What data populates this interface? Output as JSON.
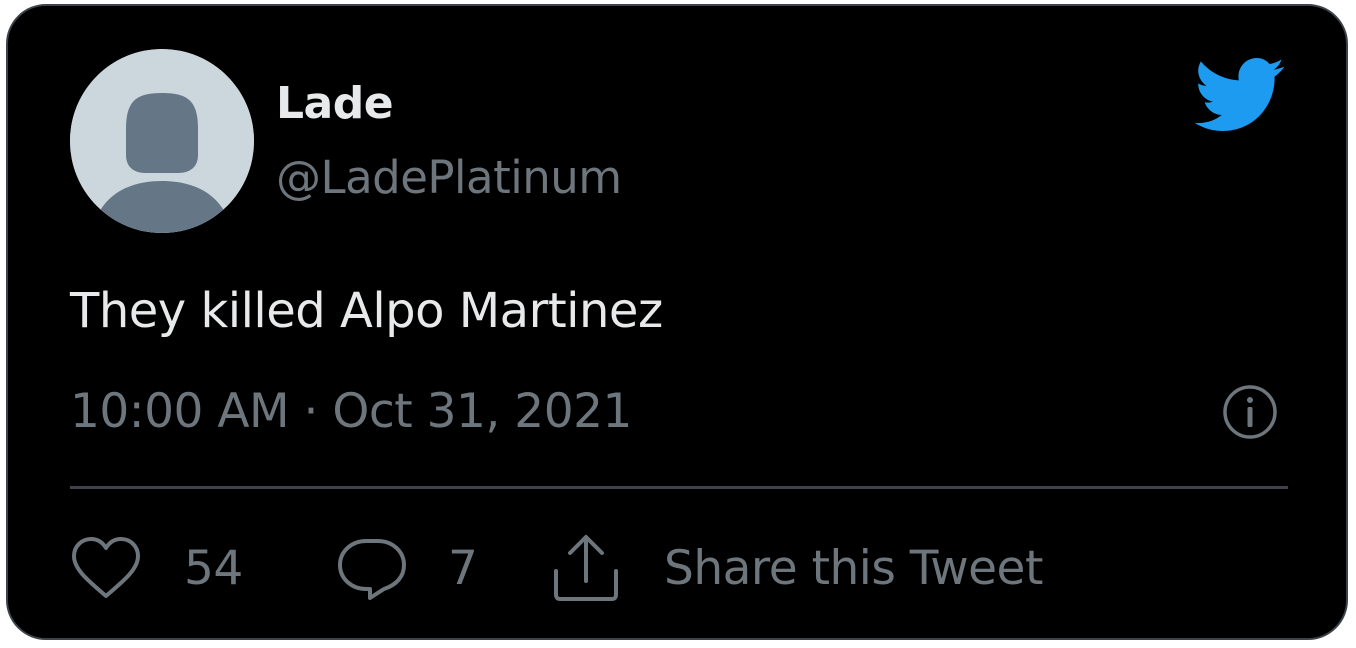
{
  "tweet": {
    "author": {
      "display_name": "Lade",
      "handle": "@LadePlatinum",
      "avatar_icon": "default-profile-avatar"
    },
    "text": "They killed Alpo Martinez",
    "timestamp": "10:00 AM · Oct 31, 2021",
    "logo_icon": "twitter-bird-icon",
    "info_icon": "info-icon",
    "actions": {
      "likes": {
        "icon": "heart-icon",
        "count": "54"
      },
      "replies": {
        "icon": "reply-bubble-icon",
        "count": "7"
      },
      "share": {
        "icon": "share-upload-icon",
        "label": "Share this Tweet"
      }
    }
  },
  "colors": {
    "background": "#000000",
    "border": "#3d4348",
    "primary_text": "#e7e9ea",
    "secondary_text": "#6e767d",
    "twitter_blue": "#1d9bf0",
    "avatar_bg": "#ccd6dd",
    "avatar_figure": "#657786"
  }
}
